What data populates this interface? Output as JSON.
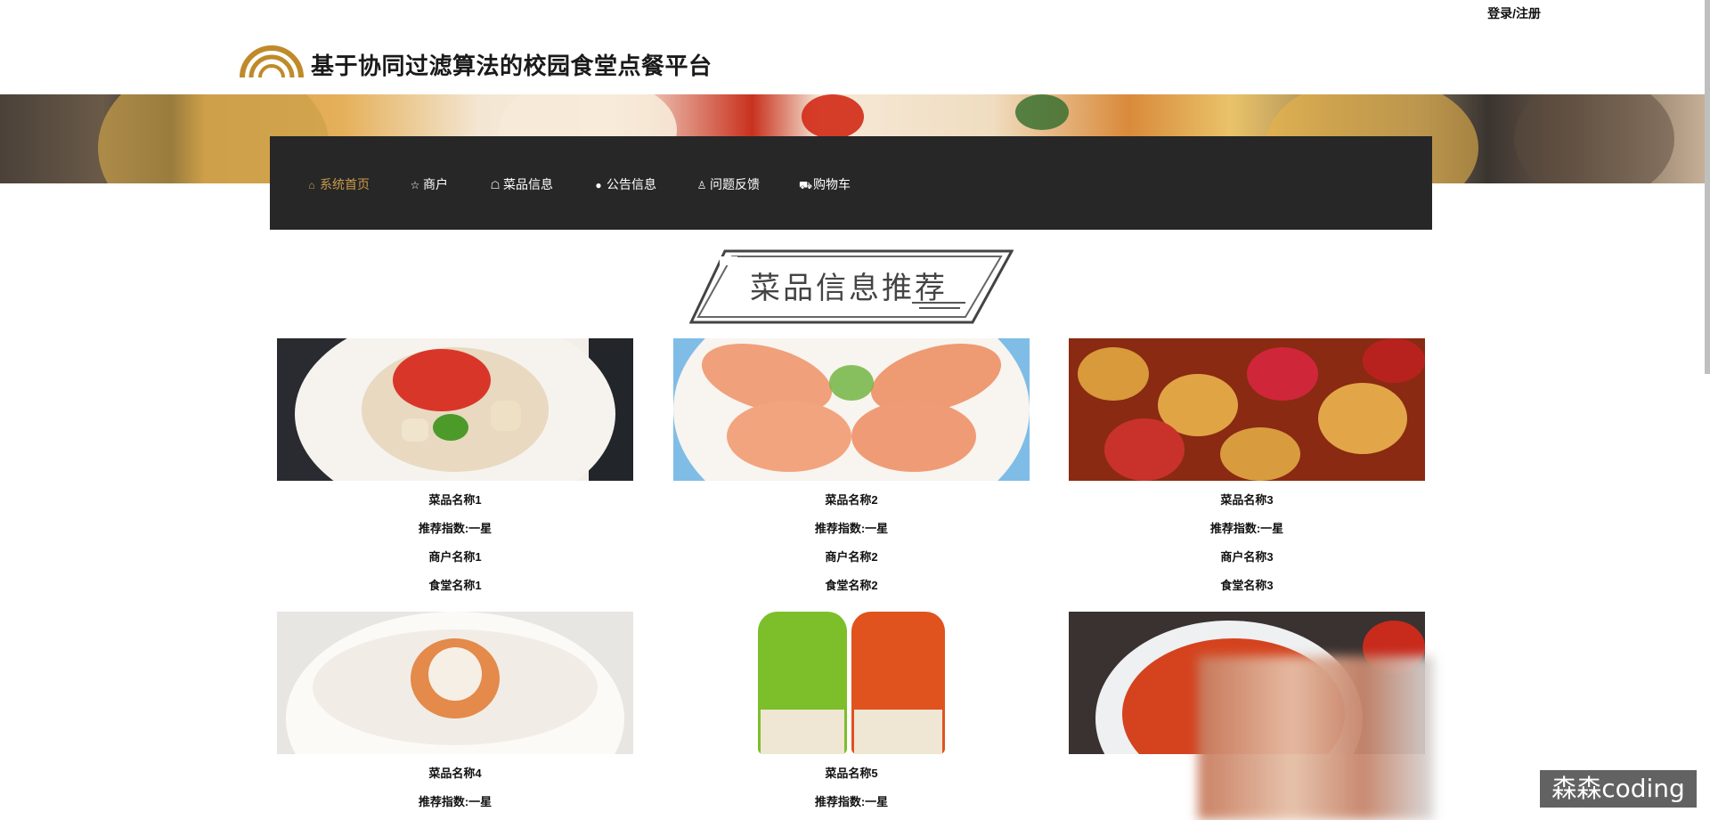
{
  "top": {
    "login_label": "登录/注册"
  },
  "header": {
    "title": "基于协同过滤算法的校园食堂点餐平台"
  },
  "nav": {
    "items": [
      {
        "label": "系统首页",
        "icon": "home-icon"
      },
      {
        "label": "商户",
        "icon": "star-icon"
      },
      {
        "label": "菜品信息",
        "icon": "bag-icon"
      },
      {
        "label": "公告信息",
        "icon": "circle-icon"
      },
      {
        "label": "问题反馈",
        "icon": "user-icon"
      },
      {
        "label": "购物车",
        "icon": "cart-icon"
      }
    ],
    "active_color": "#c99a4a",
    "bg_color": "#272727"
  },
  "section": {
    "title": "菜品信息推荐"
  },
  "dishes": [
    {
      "name": "菜品名称1",
      "rating": "推荐指数:一星",
      "merchant": "商户名称1",
      "canteen": "食堂名称1"
    },
    {
      "name": "菜品名称2",
      "rating": "推荐指数:一星",
      "merchant": "商户名称2",
      "canteen": "食堂名称2"
    },
    {
      "name": "菜品名称3",
      "rating": "推荐指数:一星",
      "merchant": "商户名称3",
      "canteen": "食堂名称3"
    },
    {
      "name": "菜品名称4",
      "rating": "推荐指数:一星"
    },
    {
      "name": "菜品名称5",
      "rating": "推荐指数:一星"
    }
  ],
  "watermark": "森森coding"
}
